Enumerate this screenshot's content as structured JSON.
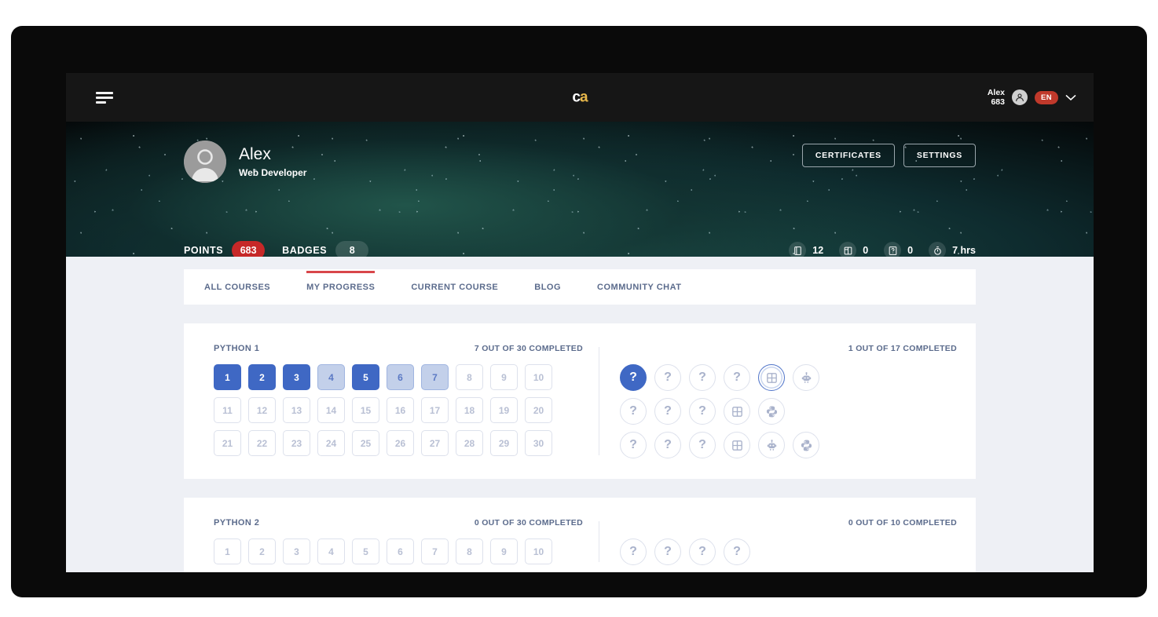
{
  "topnav": {
    "menu_icon": "hamburger-icon",
    "logo": {
      "part1": "c",
      "part2": "a"
    },
    "user_name": "Alex",
    "user_points": "683",
    "avatar_icon": "user-avatar-icon",
    "language": "EN",
    "chevron": "⌄"
  },
  "hero": {
    "avatar_icon": "profile-avatar-icon",
    "name": "Alex",
    "role": "Web Developer",
    "buttons": [
      {
        "label": "CERTIFICATES",
        "name": "certificates-button"
      },
      {
        "label": "SETTINGS",
        "name": "settings-button"
      }
    ],
    "points_label": "POINTS",
    "points_value": "683",
    "badges_label": "BADGES",
    "badges_value": "8",
    "icon_stats": [
      {
        "icon": "book-icon",
        "value": "12"
      },
      {
        "icon": "cards-icon",
        "value": "0"
      },
      {
        "icon": "quiz-icon",
        "value": "0"
      },
      {
        "icon": "stopwatch-icon",
        "value": "7 hrs"
      }
    ],
    "colors": {
      "accent_red": "#c62828",
      "pill_dark": "rgba(255,255,255,.14)"
    }
  },
  "tabs": [
    {
      "label": "ALL COURSES",
      "active": false
    },
    {
      "label": "MY PROGRESS",
      "active": true
    },
    {
      "label": "CURRENT COURSE",
      "active": false
    },
    {
      "label": "BLOG",
      "active": false
    },
    {
      "label": "COMMUNITY CHAT",
      "active": false
    }
  ],
  "tab_accent_color": "#d8474a",
  "courses": [
    {
      "title": "PYTHON 1",
      "lessons_meta": "7 OUT OF 30 COMPLETED",
      "badges_meta": "1 OUT OF 17 COMPLETED",
      "lesson_rows": [
        [
          {
            "n": "1",
            "state": "done"
          },
          {
            "n": "2",
            "state": "done"
          },
          {
            "n": "3",
            "state": "done"
          },
          {
            "n": "4",
            "state": "partial"
          },
          {
            "n": "5",
            "state": "done"
          },
          {
            "n": "6",
            "state": "partial"
          },
          {
            "n": "7",
            "state": "partial"
          },
          {
            "n": "8",
            "state": "empty"
          },
          {
            "n": "9",
            "state": "empty"
          },
          {
            "n": "10",
            "state": "empty"
          }
        ],
        [
          {
            "n": "11",
            "state": "empty"
          },
          {
            "n": "12",
            "state": "empty"
          },
          {
            "n": "13",
            "state": "empty"
          },
          {
            "n": "14",
            "state": "empty"
          },
          {
            "n": "15",
            "state": "empty"
          },
          {
            "n": "16",
            "state": "empty"
          },
          {
            "n": "17",
            "state": "empty"
          },
          {
            "n": "18",
            "state": "empty"
          },
          {
            "n": "19",
            "state": "empty"
          },
          {
            "n": "20",
            "state": "empty"
          }
        ],
        [
          {
            "n": "21",
            "state": "empty"
          },
          {
            "n": "22",
            "state": "empty"
          },
          {
            "n": "23",
            "state": "empty"
          },
          {
            "n": "24",
            "state": "empty"
          },
          {
            "n": "25",
            "state": "empty"
          },
          {
            "n": "26",
            "state": "empty"
          },
          {
            "n": "27",
            "state": "empty"
          },
          {
            "n": "28",
            "state": "empty"
          },
          {
            "n": "29",
            "state": "empty"
          },
          {
            "n": "30",
            "state": "empty"
          }
        ]
      ],
      "badge_rows": [
        [
          {
            "icon": "question-icon",
            "state": "filled"
          },
          {
            "icon": "question-icon",
            "state": "locked"
          },
          {
            "icon": "question-icon",
            "state": "locked"
          },
          {
            "icon": "question-icon",
            "state": "locked"
          },
          {
            "icon": "grid-icon",
            "state": "ringed"
          },
          {
            "icon": "robot-icon",
            "state": "locked"
          }
        ],
        [
          {
            "icon": "question-icon",
            "state": "locked"
          },
          {
            "icon": "question-icon",
            "state": "locked"
          },
          {
            "icon": "question-icon",
            "state": "locked"
          },
          {
            "icon": "grid-icon",
            "state": "locked"
          },
          {
            "icon": "python-icon",
            "state": "locked"
          }
        ],
        [
          {
            "icon": "question-icon",
            "state": "locked"
          },
          {
            "icon": "question-icon",
            "state": "locked"
          },
          {
            "icon": "question-icon",
            "state": "locked"
          },
          {
            "icon": "grid-icon",
            "state": "locked"
          },
          {
            "icon": "robot-icon",
            "state": "locked"
          },
          {
            "icon": "python-icon",
            "state": "locked"
          }
        ]
      ]
    },
    {
      "title": "PYTHON 2",
      "lessons_meta": "0 OUT OF 30 COMPLETED",
      "badges_meta": "0 OUT OF 10 COMPLETED",
      "lesson_rows": [
        [
          {
            "n": "1",
            "state": "empty"
          },
          {
            "n": "2",
            "state": "empty"
          },
          {
            "n": "3",
            "state": "empty"
          },
          {
            "n": "4",
            "state": "empty"
          },
          {
            "n": "5",
            "state": "empty"
          },
          {
            "n": "6",
            "state": "empty"
          },
          {
            "n": "7",
            "state": "empty"
          },
          {
            "n": "8",
            "state": "empty"
          },
          {
            "n": "9",
            "state": "empty"
          },
          {
            "n": "10",
            "state": "empty"
          }
        ]
      ],
      "badge_rows": [
        [
          {
            "icon": "question-icon",
            "state": "locked"
          },
          {
            "icon": "question-icon",
            "state": "locked"
          },
          {
            "icon": "question-icon",
            "state": "locked"
          },
          {
            "icon": "question-icon",
            "state": "locked"
          }
        ]
      ]
    }
  ]
}
